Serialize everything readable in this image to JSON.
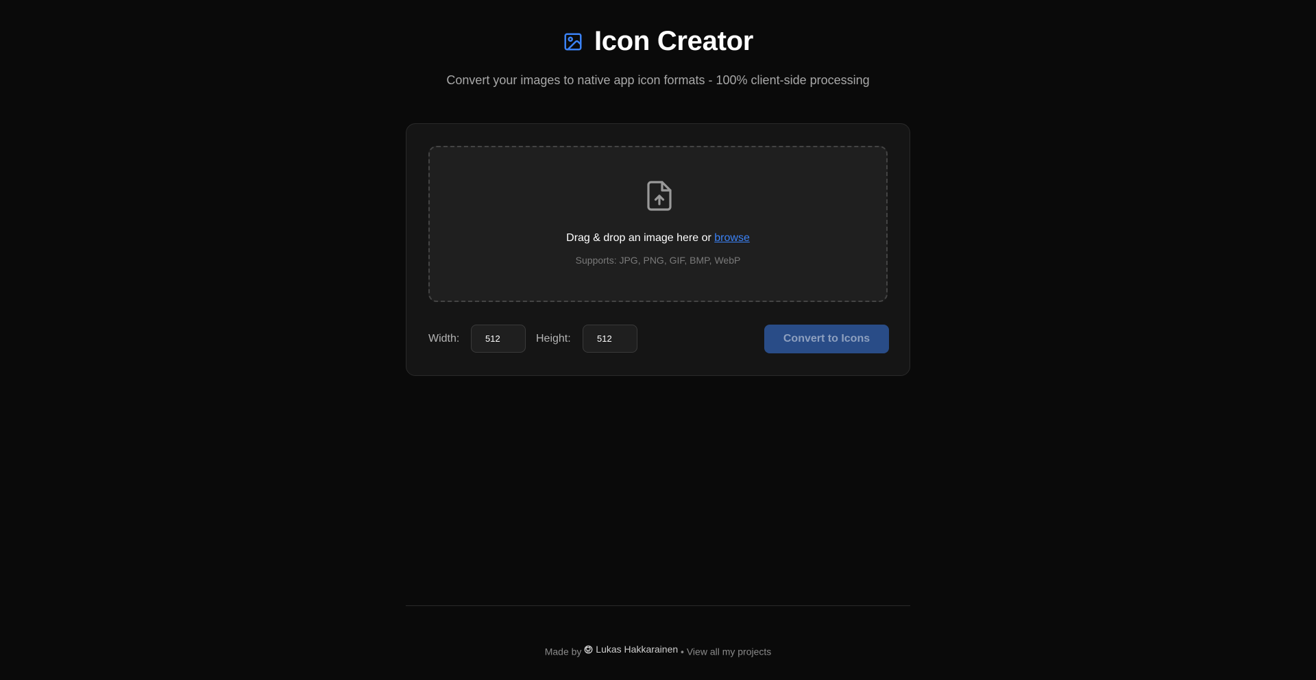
{
  "header": {
    "icon": "image-icon",
    "title": "Icon Creator",
    "subtitle": "Convert your images to native app icon formats - 100% client-side processing"
  },
  "dropzone": {
    "icon": "file-upload-icon",
    "prompt": "Drag & drop an image here or ",
    "browse_label": "browse",
    "supports": "Supports: JPG, PNG, GIF, BMP, WebP"
  },
  "controls": {
    "width_label": "Width:",
    "width_value": "512",
    "height_label": "Height:",
    "height_value": "512",
    "convert_label": "Convert to Icons"
  },
  "footer": {
    "made_by": "Made by",
    "author_icon": "github-icon",
    "author_name": "Lukas Hakkarainen",
    "separator": "•",
    "projects_link": "View all my projects"
  },
  "colors": {
    "background": "#0a0a0a",
    "card": "#151515",
    "accent": "#3b82f6",
    "button": "#294c87"
  }
}
